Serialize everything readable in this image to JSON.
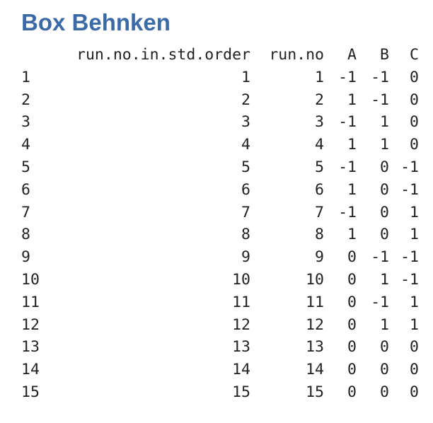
{
  "title": "Box Behnken",
  "table": {
    "columns": [
      "",
      "run.no.in.std.order",
      "run.no",
      "A",
      "B",
      "C"
    ],
    "rows": [
      [
        "1",
        "1",
        "1",
        "-1",
        "-1",
        "0"
      ],
      [
        "2",
        "2",
        "2",
        "1",
        "-1",
        "0"
      ],
      [
        "3",
        "3",
        "3",
        "-1",
        "1",
        "0"
      ],
      [
        "4",
        "4",
        "4",
        "1",
        "1",
        "0"
      ],
      [
        "5",
        "5",
        "5",
        "-1",
        "0",
        "-1"
      ],
      [
        "6",
        "6",
        "6",
        "1",
        "0",
        "-1"
      ],
      [
        "7",
        "7",
        "7",
        "-1",
        "0",
        "1"
      ],
      [
        "8",
        "8",
        "8",
        "1",
        "0",
        "1"
      ],
      [
        "9",
        "9",
        "9",
        "0",
        "-1",
        "-1"
      ],
      [
        "10",
        "10",
        "10",
        "0",
        "1",
        "-1"
      ],
      [
        "11",
        "11",
        "11",
        "0",
        "-1",
        "1"
      ],
      [
        "12",
        "12",
        "12",
        "0",
        "1",
        "1"
      ],
      [
        "13",
        "13",
        "13",
        "0",
        "0",
        "0"
      ],
      [
        "14",
        "14",
        "14",
        "0",
        "0",
        "0"
      ],
      [
        "15",
        "15",
        "15",
        "0",
        "0",
        "0"
      ]
    ]
  }
}
